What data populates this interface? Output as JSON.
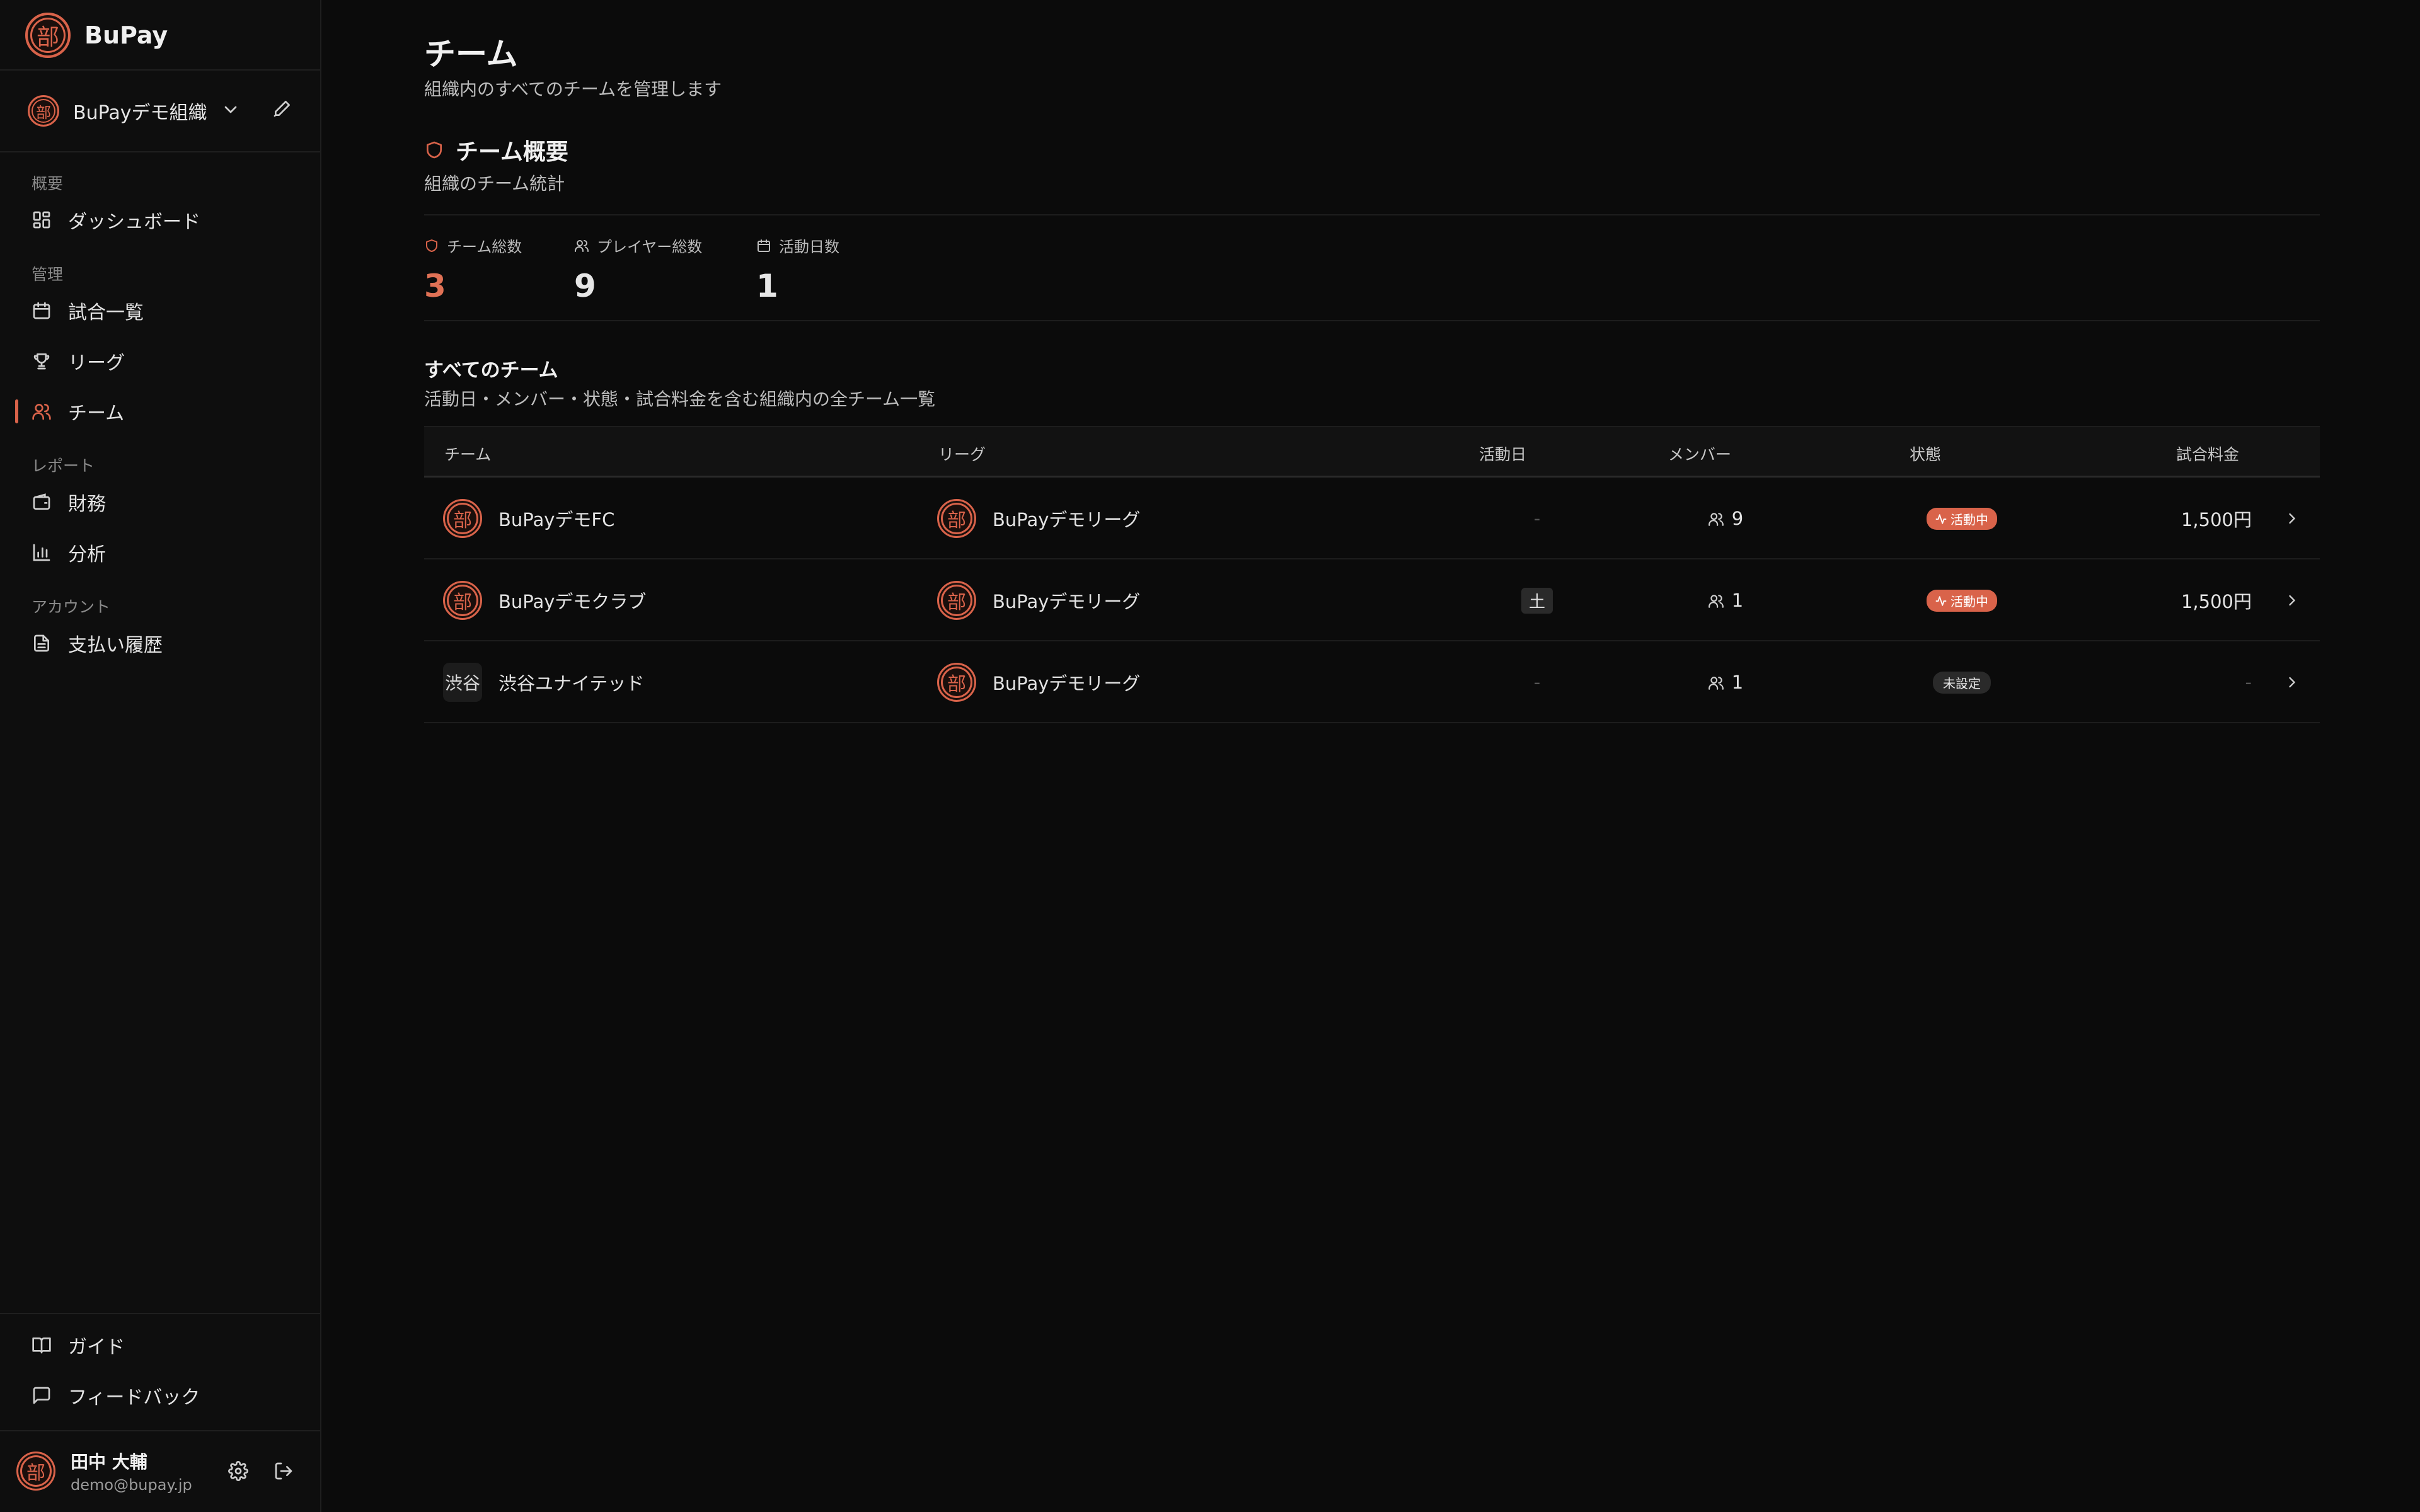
{
  "brand": {
    "name": "BuPay",
    "logo_char": "部"
  },
  "org": {
    "name": "BuPayデモ組織"
  },
  "nav": {
    "sections": {
      "overview": "概要",
      "manage": "管理",
      "report": "レポート",
      "account": "アカウント"
    },
    "items": {
      "dashboard": "ダッシュボード",
      "matches": "試合一覧",
      "league": "リーグ",
      "teams": "チーム",
      "finance": "財務",
      "analytics": "分析",
      "payments": "支払い履歴",
      "guide": "ガイド",
      "feedback": "フィードバック"
    }
  },
  "user": {
    "name": "田中 大輔",
    "email": "demo@bupay.jp"
  },
  "page": {
    "title": "チーム",
    "subtitle": "組織内のすべてのチームを管理します"
  },
  "overview": {
    "title": "チーム概要",
    "subtitle": "組織のチーム統計",
    "stats": [
      {
        "label": "チーム総数",
        "value": "3"
      },
      {
        "label": "プレイヤー総数",
        "value": "9"
      },
      {
        "label": "活動日数",
        "value": "1"
      }
    ]
  },
  "list": {
    "title": "すべてのチーム",
    "subtitle": "活動日・メンバー・状態・試合料金を含む組織内の全チーム一覧",
    "columns": {
      "team": "チーム",
      "league": "リーグ",
      "day": "活動日",
      "members": "メンバー",
      "status": "状態",
      "fee": "試合料金"
    },
    "rows": [
      {
        "team": "BuPayデモFC",
        "league": "BuPayデモリーグ",
        "day": "-",
        "members": "9",
        "status": "活動中",
        "fee": "1,500円"
      },
      {
        "team": "BuPayデモクラブ",
        "league": "BuPayデモリーグ",
        "day": "土",
        "members": "1",
        "status": "活動中",
        "fee": "1,500円"
      },
      {
        "team": "渋谷ユナイテッド",
        "team_avatar": "渋谷",
        "league": "BuPayデモリーグ",
        "day": "-",
        "members": "1",
        "status": "未設定",
        "fee": "-"
      }
    ]
  },
  "colors": {
    "accent": "#d9634a",
    "background": "#0b0b0b",
    "sidebar": "#0e0e0e"
  }
}
